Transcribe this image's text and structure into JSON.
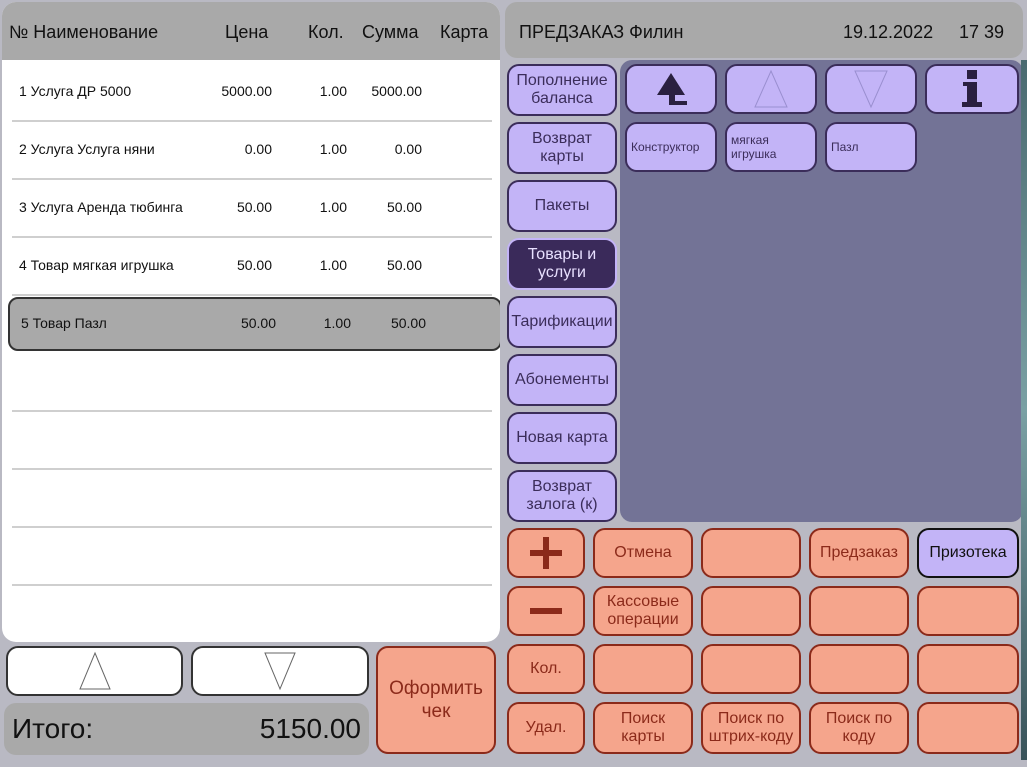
{
  "receipt": {
    "headers": {
      "name": "№ Наименование",
      "price": "Цена",
      "qty": "Кол.",
      "sum": "Сумма",
      "card": "Карта"
    },
    "rows": [
      {
        "name": "1 Услуга ДР 5000",
        "price": "5000.00",
        "qty": "1.00",
        "sum": "5000.00"
      },
      {
        "name": "2 Услуга Услуга няни",
        "price": "0.00",
        "qty": "1.00",
        "sum": "0.00"
      },
      {
        "name": "3 Услуга Аренда тюбинга",
        "price": "50.00",
        "qty": "1.00",
        "sum": "50.00"
      },
      {
        "name": "4 Товар мягкая игрушка",
        "price": "50.00",
        "qty": "1.00",
        "sum": "50.00"
      },
      {
        "name": "5 Товар Пазл",
        "price": "50.00",
        "qty": "1.00",
        "sum": "50.00"
      }
    ],
    "selected_row": 5,
    "total_label": "Итого:",
    "total_value": "5150.00",
    "checkout_label_1": "Оформить",
    "checkout_label_2": "чек"
  },
  "header": {
    "title": "ПРЕДЗАКАЗ Филин",
    "date": "19.12.2022",
    "time": "17 39"
  },
  "categories": [
    {
      "l1": "Пополнение",
      "l2": "баланса"
    },
    {
      "l1": "Возврат",
      "l2": "карты"
    },
    {
      "l1": "Пакеты",
      "l2": ""
    },
    {
      "l1": "Товары и",
      "l2": "услуги"
    },
    {
      "l1": "Тарификации",
      "l2": ""
    },
    {
      "l1": "Абонементы",
      "l2": ""
    },
    {
      "l1": "Новая карта",
      "l2": ""
    },
    {
      "l1": "Возврат",
      "l2": "залога (к)"
    }
  ],
  "active_category": 3,
  "items": [
    {
      "l1": "Конструктор",
      "l2": ""
    },
    {
      "l1": "мягкая",
      "l2": "игрушка"
    },
    {
      "l1": "Пазл",
      "l2": ""
    }
  ],
  "keypad": {
    "plus": "+",
    "minus": "−",
    "cancel": "Отмена",
    "preorder": "Предзаказ",
    "prize": "Призотека",
    "cash_ops_1": "Кассовые",
    "cash_ops_2": "операции",
    "qty": "Кол.",
    "delete": "Удал.",
    "find_card_1": "Поиск",
    "find_card_2": "карты",
    "find_barcode_1": "Поиск по",
    "find_barcode_2": "штрих-коду",
    "find_code_1": "Поиск по",
    "find_code_2": "коду"
  },
  "colors": {
    "salmon": "#f5a58c",
    "salmon_border": "#8b2a1a",
    "purple": "#c3b4f7",
    "purple_dark": "#3a2a5a",
    "panel_bg": "#737396"
  }
}
